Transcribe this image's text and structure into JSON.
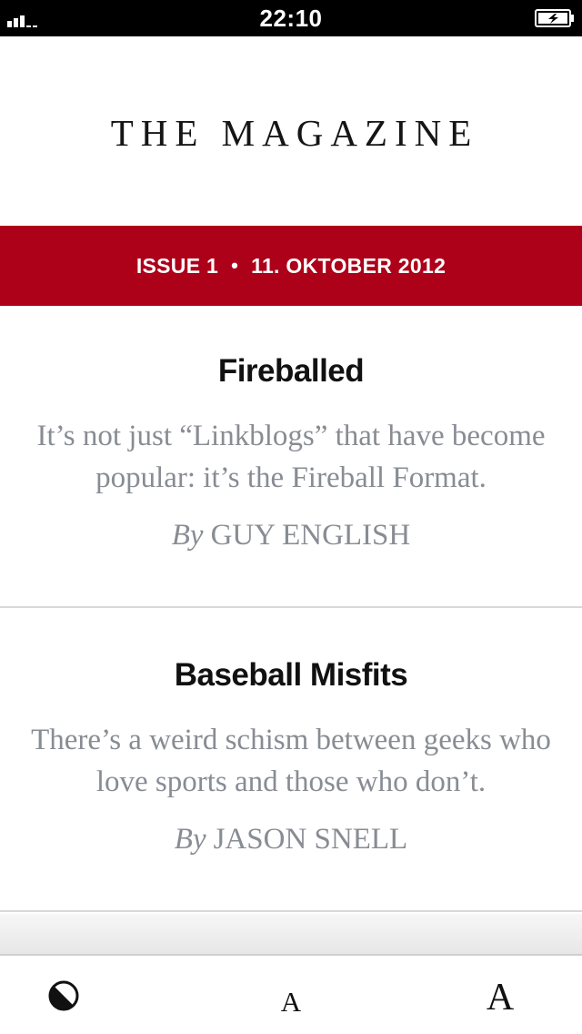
{
  "status_bar": {
    "time": "22:10",
    "signal_icon": "signal-bars-icon",
    "battery_icon": "battery-charging-icon"
  },
  "masthead": {
    "title": "THE MAGAZINE"
  },
  "issue_banner": {
    "issue": "ISSUE 1",
    "separator": "•",
    "date": "11. OKTOBER 2012",
    "background": "#ad0019"
  },
  "articles": [
    {
      "title": "Fireballed",
      "summary": "It’s not just “Linkblogs” that have become popular: it’s the Fireball Format.",
      "byline_prefix": "By",
      "author": "GUY ENGLISH"
    },
    {
      "title": "Baseball Misfits",
      "summary": "There’s a weird schism between geeks who love sports and those who don’t.",
      "byline_prefix": "By",
      "author": "JASON SNELL"
    }
  ],
  "toolbar": {
    "contrast_icon": "contrast-toggle-icon",
    "smaller_text_label": "A",
    "larger_text_label": "A"
  }
}
